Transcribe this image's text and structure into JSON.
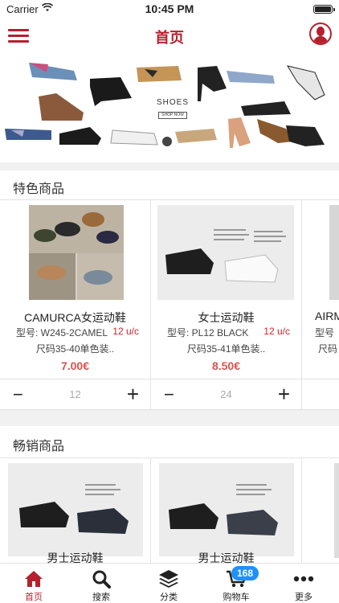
{
  "status_bar": {
    "carrier": "Carrier",
    "time": "10:45 PM"
  },
  "header": {
    "title": "首页"
  },
  "banner": {
    "label": "SHOES",
    "sub_label": "SHOP NOW"
  },
  "sections": {
    "featured": {
      "title": "特色商品",
      "products": [
        {
          "name": "CAMURCA女运动鞋",
          "model": "型号: W245-2CAMEL",
          "pack": "12 u/c",
          "desc": "尺码35-40单色装..",
          "price": "7.00€",
          "qty": "12"
        },
        {
          "name": "女士运动鞋",
          "model": "型号: PL12 BLACK",
          "pack": "12 u/c",
          "desc": "尺码35-41单色装..",
          "price": "8.50€",
          "qty": "24"
        },
        {
          "name": "AIRM",
          "model": "型号",
          "pack": "",
          "desc": "尺码",
          "price": "",
          "qty": ""
        }
      ]
    },
    "bestsellers": {
      "title": "畅销商品",
      "products": [
        {
          "name": "男士运动鞋"
        },
        {
          "name": "男士运动鞋"
        }
      ]
    }
  },
  "tab_bar": {
    "tabs": [
      {
        "label": "首页",
        "icon": "home-icon"
      },
      {
        "label": "搜索",
        "icon": "search-icon"
      },
      {
        "label": "分类",
        "icon": "layers-icon"
      },
      {
        "label": "购物车",
        "icon": "cart-icon"
      },
      {
        "label": "更多",
        "icon": "more-icon"
      }
    ],
    "cart_badge": "168"
  },
  "colors": {
    "brand": "#b5202e",
    "price": "#d9534f",
    "badge": "#1e90ff"
  }
}
